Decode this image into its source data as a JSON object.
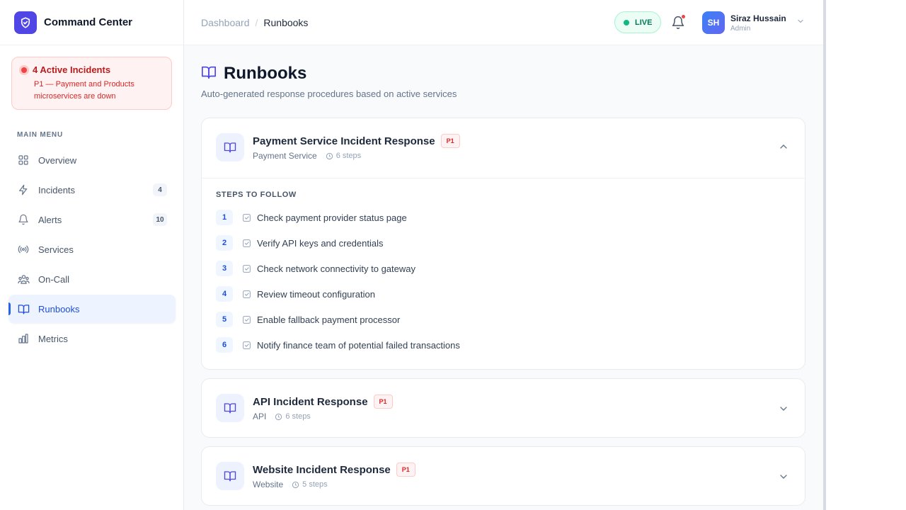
{
  "app": {
    "title": "Command Center"
  },
  "incident_alert": {
    "title": "4 Active Incidents",
    "description": "P1 — Payment and Products microservices are down"
  },
  "sidebar": {
    "section_label": "MAIN MENU",
    "items": [
      {
        "label": "Overview",
        "icon": "grid-icon",
        "badge": null,
        "active": false
      },
      {
        "label": "Incidents",
        "icon": "lightning-icon",
        "badge": "4",
        "active": false
      },
      {
        "label": "Alerts",
        "icon": "bell-icon",
        "badge": "10",
        "active": false
      },
      {
        "label": "Services",
        "icon": "broadcast-icon",
        "badge": null,
        "active": false
      },
      {
        "label": "On-Call",
        "icon": "users-icon",
        "badge": null,
        "active": false
      },
      {
        "label": "Runbooks",
        "icon": "book-icon",
        "badge": null,
        "active": true
      },
      {
        "label": "Metrics",
        "icon": "bar-chart-icon",
        "badge": null,
        "active": false
      }
    ]
  },
  "header": {
    "breadcrumb": [
      "Dashboard",
      "Runbooks"
    ],
    "separator": "/",
    "live_label": "LIVE",
    "user": {
      "initials": "SH",
      "name": "Siraz Hussain",
      "role": "Admin"
    }
  },
  "page": {
    "title": "Runbooks",
    "subtitle": "Auto-generated response procedures based on active services"
  },
  "runbooks": [
    {
      "title": "Payment Service Incident Response",
      "priority": "P1",
      "service": "Payment Service",
      "steps_count": "6 steps",
      "expanded": true,
      "steps_label": "STEPS TO FOLLOW",
      "steps": [
        {
          "num": "1",
          "text": "Check payment provider status page"
        },
        {
          "num": "2",
          "text": "Verify API keys and credentials"
        },
        {
          "num": "3",
          "text": "Check network connectivity to gateway"
        },
        {
          "num": "4",
          "text": "Review timeout configuration"
        },
        {
          "num": "5",
          "text": "Enable fallback payment processor"
        },
        {
          "num": "6",
          "text": "Notify finance team of potential failed transactions"
        }
      ]
    },
    {
      "title": "API Incident Response",
      "priority": "P1",
      "service": "API",
      "steps_count": "6 steps",
      "expanded": false
    },
    {
      "title": "Website Incident Response",
      "priority": "P1",
      "service": "Website",
      "steps_count": "5 steps",
      "expanded": false
    }
  ],
  "colors": {
    "accent": "#4f46e5",
    "active_nav": "#1d4ed8",
    "danger": "#dc2626",
    "live": "#10b981"
  }
}
